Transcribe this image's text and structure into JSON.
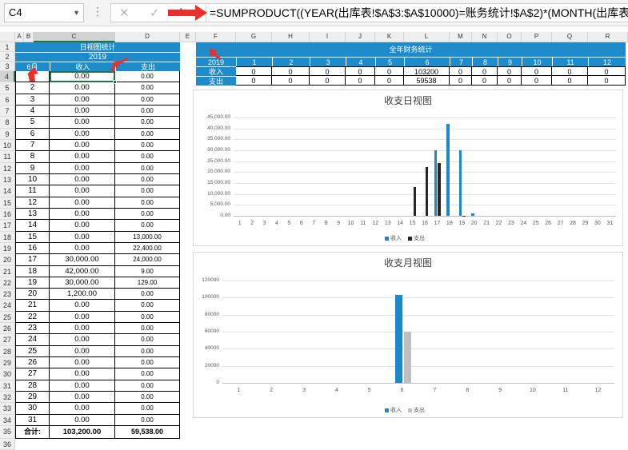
{
  "formula_bar": {
    "name_box": "C4",
    "formula": "=SUMPRODUCT((YEAR(出库表!$A$3:$A$10000)=账务统计!$A$2)*(MONTH(出库表!$A"
  },
  "columns": [
    "A",
    "B",
    "C",
    "D",
    "E",
    "F",
    "G",
    "H",
    "I",
    "J",
    "K",
    "L",
    "M",
    "N",
    "O",
    "P",
    "Q",
    "R"
  ],
  "rows": [
    "1",
    "2",
    "3",
    "4",
    "5",
    "6",
    "7",
    "8",
    "9",
    "10",
    "11",
    "12",
    "13",
    "14",
    "15",
    "16",
    "17",
    "18",
    "19",
    "20",
    "21",
    "22",
    "23",
    "24",
    "25",
    "26",
    "27",
    "28",
    "29",
    "30",
    "31",
    "32",
    "33",
    "34",
    "35",
    "36"
  ],
  "daily": {
    "title": "日视图统计",
    "year": "2019",
    "month_label": "6月",
    "income_label": "收入",
    "expense_label": "支出",
    "days": [
      [
        "1",
        "0.00",
        "0.00"
      ],
      [
        "2",
        "0.00",
        "0.00"
      ],
      [
        "3",
        "0.00",
        "0.00"
      ],
      [
        "4",
        "0.00",
        "0.00"
      ],
      [
        "5",
        "0.00",
        "0.00"
      ],
      [
        "6",
        "0.00",
        "0.00"
      ],
      [
        "7",
        "0.00",
        "0.00"
      ],
      [
        "8",
        "0.00",
        "0.00"
      ],
      [
        "9",
        "0.00",
        "0.00"
      ],
      [
        "10",
        "0.00",
        "0.00"
      ],
      [
        "11",
        "0.00",
        "0.00"
      ],
      [
        "12",
        "0.00",
        "0.00"
      ],
      [
        "13",
        "0.00",
        "0.00"
      ],
      [
        "14",
        "0.00",
        "0.00"
      ],
      [
        "15",
        "0.00",
        "13,000.00"
      ],
      [
        "16",
        "0.00",
        "22,400.00"
      ],
      [
        "17",
        "30,000.00",
        "24,000.00"
      ],
      [
        "18",
        "42,000.00",
        "9.00"
      ],
      [
        "19",
        "30,000.00",
        "129.00"
      ],
      [
        "20",
        "1,200.00",
        "0.00"
      ],
      [
        "21",
        "0.00",
        "0.00"
      ],
      [
        "22",
        "0.00",
        "0.00"
      ],
      [
        "23",
        "0.00",
        "0.00"
      ],
      [
        "24",
        "0.00",
        "0.00"
      ],
      [
        "25",
        "0.00",
        "0.00"
      ],
      [
        "26",
        "0.00",
        "0.00"
      ],
      [
        "27",
        "0.00",
        "0.00"
      ],
      [
        "28",
        "0.00",
        "0.00"
      ],
      [
        "29",
        "0.00",
        "0.00"
      ],
      [
        "30",
        "0.00",
        "0.00"
      ],
      [
        "31",
        "0.00",
        "0.00"
      ]
    ],
    "total_label": "合计:",
    "total_income": "103,200.00",
    "total_expense": "59,538.00"
  },
  "annual": {
    "title": "全年财务统计",
    "year": "2019",
    "months": [
      "1",
      "2",
      "3",
      "4",
      "5",
      "6",
      "7",
      "8",
      "9",
      "10",
      "11",
      "12"
    ],
    "income_label": "收入",
    "expense_label": "支出",
    "income": [
      "0",
      "0",
      "0",
      "0",
      "0",
      "103200",
      "0",
      "0",
      "0",
      "0",
      "0",
      "0"
    ],
    "expense": [
      "0",
      "0",
      "0",
      "0",
      "0",
      "59538",
      "0",
      "0",
      "0",
      "0",
      "0",
      "0"
    ]
  },
  "colors": {
    "income": "#1e87c8",
    "expense_daily": "#262626",
    "expense_monthly": "#bfbfbf",
    "header_blue": "#1e8bcb",
    "arrow": "#e8302f"
  },
  "chart_data": [
    {
      "type": "bar",
      "title": "收支日视图",
      "categories": [
        "1",
        "2",
        "3",
        "4",
        "5",
        "6",
        "7",
        "8",
        "9",
        "10",
        "11",
        "12",
        "13",
        "14",
        "15",
        "16",
        "17",
        "18",
        "19",
        "20",
        "21",
        "22",
        "23",
        "24",
        "25",
        "26",
        "27",
        "28",
        "29",
        "30",
        "31"
      ],
      "series": [
        {
          "name": "收入",
          "values": [
            0,
            0,
            0,
            0,
            0,
            0,
            0,
            0,
            0,
            0,
            0,
            0,
            0,
            0,
            0,
            0,
            30000,
            42000,
            30000,
            1200,
            0,
            0,
            0,
            0,
            0,
            0,
            0,
            0,
            0,
            0,
            0
          ]
        },
        {
          "name": "支出",
          "values": [
            0,
            0,
            0,
            0,
            0,
            0,
            0,
            0,
            0,
            0,
            0,
            0,
            0,
            0,
            13000,
            22400,
            24000,
            9,
            129,
            0,
            0,
            0,
            0,
            0,
            0,
            0,
            0,
            0,
            0,
            0,
            0
          ]
        }
      ],
      "yticks": [
        "0.00",
        "5,000.00",
        "10,000.00",
        "15,000.00",
        "20,000.00",
        "25,000.00",
        "30,000.00",
        "35,000.00",
        "40,000.00",
        "45,000.00"
      ],
      "ylim": [
        0,
        45000
      ],
      "legend": "bottom"
    },
    {
      "type": "bar",
      "title": "收支月视图",
      "categories": [
        "1",
        "2",
        "3",
        "4",
        "5",
        "6",
        "7",
        "8",
        "9",
        "10",
        "11",
        "12"
      ],
      "series": [
        {
          "name": "收入",
          "values": [
            0,
            0,
            0,
            0,
            0,
            103200,
            0,
            0,
            0,
            0,
            0,
            0
          ]
        },
        {
          "name": "支出",
          "values": [
            0,
            0,
            0,
            0,
            0,
            59538,
            0,
            0,
            0,
            0,
            0,
            0
          ]
        }
      ],
      "yticks": [
        "0",
        "20000",
        "40000",
        "60000",
        "80000",
        "100000",
        "120000"
      ],
      "ylim": [
        0,
        120000
      ],
      "legend": "bottom"
    }
  ]
}
